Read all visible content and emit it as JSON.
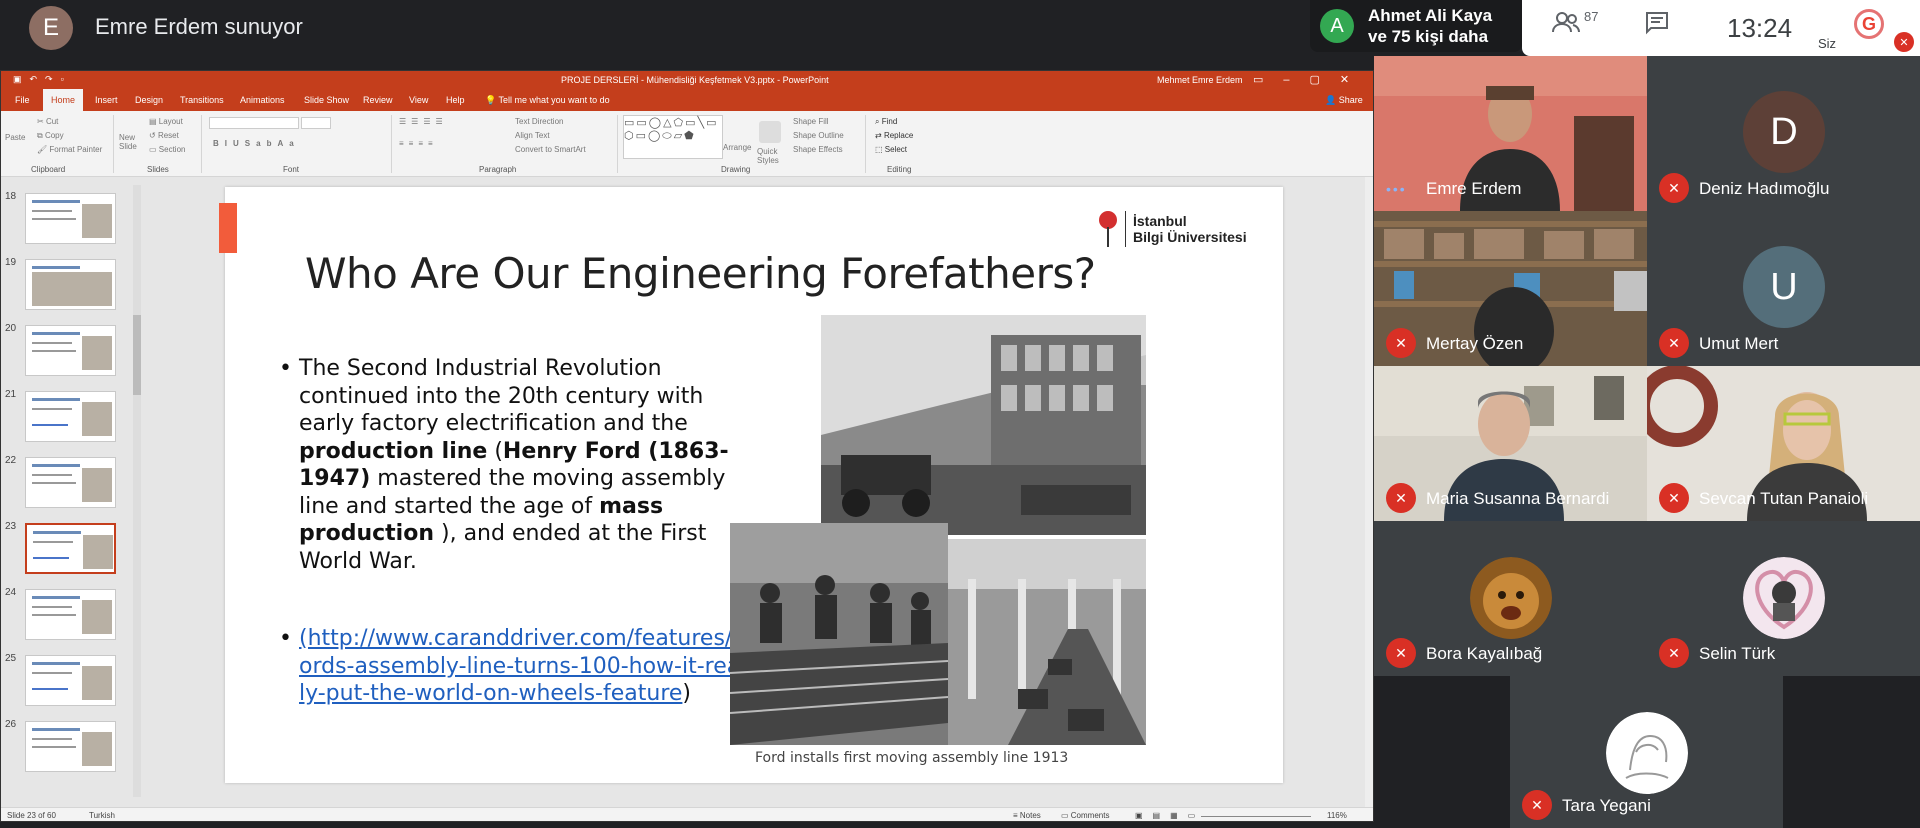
{
  "top_bar": {
    "presenter_initial": "E",
    "presenter_text": "Emre Erdem sunuyor",
    "speaker_initial": "A",
    "speaker_line1": "Ahmet Ali Kaya",
    "speaker_line2": "ve 75 kişi daha",
    "participants_icon": "people-icon",
    "participants_count": "87",
    "chat_icon": "chat-icon",
    "clock": "13:24",
    "self_label": "Siz",
    "self_logo": "G"
  },
  "powerpoint": {
    "document_title": "PROJE DERSLERİ - Mühendisliği Keşfetmek V3.pptx  -  PowerPoint",
    "user_name": "Mehmet Emre Erdem",
    "tabs": [
      "File",
      "Home",
      "Insert",
      "Design",
      "Transitions",
      "Animations",
      "Slide Show",
      "Review",
      "View",
      "Help"
    ],
    "tell_me": "Tell me what you want to do",
    "share_label": "Share",
    "ribbon": {
      "cut": "Cut",
      "copy": "Copy",
      "format_painter": "Format Painter",
      "paste": "Paste",
      "clipboard": "Clipboard",
      "new_slide": "New Slide",
      "layout": "Layout",
      "reset": "Reset",
      "section": "Section",
      "slides": "Slides",
      "font": "Font",
      "paragraph": "Paragraph",
      "text_direction": "Text Direction",
      "align_text": "Align Text",
      "convert_smartart": "Convert to SmartArt",
      "arrange": "Arrange",
      "quick_styles": "Quick Styles",
      "shape_fill": "Shape Fill",
      "shape_outline": "Shape Outline",
      "shape_effects": "Shape Effects",
      "drawing": "Drawing",
      "find": "Find",
      "replace": "Replace",
      "select": "Select",
      "editing": "Editing"
    },
    "thumbnails": [
      "18",
      "19",
      "20",
      "21",
      "22",
      "23",
      "24",
      "25",
      "26"
    ],
    "selected_thumbnail": "23",
    "status": {
      "slide_info": "Slide 23 of 60",
      "language": "Turkish",
      "notes": "Notes",
      "comments": "Comments",
      "zoom": "116%"
    }
  },
  "slide": {
    "title": "Who Are Our Engineering Forefathers?",
    "logo_line1": "İstanbul",
    "logo_line2": "Bilgi Üniversitesi",
    "bullet1": {
      "t1": "The Second Industrial Revolution continued into the 20th century with early factory electrification and the ",
      "b1": "production line",
      "t2": " (",
      "b2": "Henry Ford (1863-1947)",
      "t3": " mastered the moving assembly line and started the age of ",
      "b3": "mass production",
      "t4": " ), and ended at the First World War."
    },
    "bullet2": {
      "link": "(http://www.caranddriver.com/features/fords-assembly-line-turns-100-how-it-really-put-the-world-on-wheels-feature",
      "close": ")"
    },
    "caption": "Ford installs first moving assembly line 1913"
  },
  "participants": [
    {
      "name": "Emre Erdem",
      "type": "video",
      "muted": false
    },
    {
      "name": "Deniz Hadımoğlu",
      "type": "initial",
      "initial": "D",
      "color": "#5d4037",
      "muted": true
    },
    {
      "name": "Mertay Özen",
      "type": "video",
      "muted": true
    },
    {
      "name": "Umut Mert",
      "type": "initial",
      "initial": "U",
      "color": "#546e7a",
      "muted": true
    },
    {
      "name": "Maria Susanna Bernardi",
      "type": "video",
      "muted": true
    },
    {
      "name": "Sevcan Tutan Panaioli",
      "type": "video",
      "muted": true
    },
    {
      "name": "Bora Kayalıbağ",
      "type": "avatar",
      "muted": true
    },
    {
      "name": "Selin Türk",
      "type": "avatar",
      "muted": true
    },
    {
      "name": "Tara Yegani",
      "type": "avatar",
      "muted": true
    }
  ],
  "icons": {
    "mic_off": "mic-off-icon",
    "more": "more-dots-icon"
  }
}
